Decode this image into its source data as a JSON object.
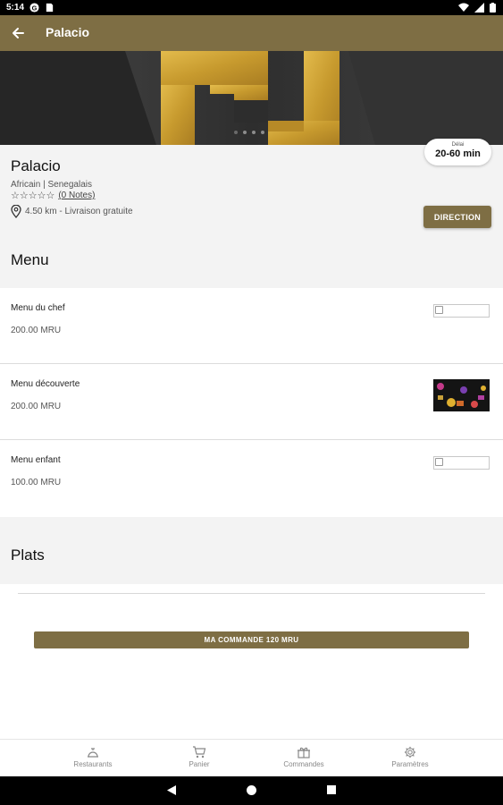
{
  "status_bar": {
    "time": "5:14",
    "icons_left": [
      "g-icon",
      "sim-icon"
    ],
    "icons_right": [
      "wifi-icon",
      "signal-icon",
      "battery-icon"
    ]
  },
  "app_bar": {
    "title": "Palacio",
    "back_icon": "arrow-left-icon"
  },
  "hero": {
    "carousel_dots": 4
  },
  "restaurant": {
    "name": "Palacio",
    "cuisine": "Africain | Senegalais",
    "stars": "☆☆☆☆☆",
    "notes": "(0 Notes)",
    "distance": "4.50 km - Livraison gratuite",
    "direction_label": "DIRECTION",
    "delay_label": "Délai",
    "delay_value": "20-60 min"
  },
  "menu_section": {
    "title": "Menu",
    "items": [
      {
        "name": "Menu du chef",
        "price": "200.00 MRU"
      },
      {
        "name": "Menu découverte",
        "price": "200.00 MRU"
      },
      {
        "name": "Menu enfant",
        "price": "100.00 MRU"
      }
    ]
  },
  "plats_section": {
    "title": "Plats"
  },
  "order_button": {
    "label": "MA COMMANDE 120 MRU"
  },
  "bottom_nav": [
    {
      "label": "Restaurants",
      "icon": "restaurant-icon"
    },
    {
      "label": "Panier",
      "icon": "cart-icon"
    },
    {
      "label": "Commandes",
      "icon": "gift-icon"
    },
    {
      "label": "Paramètres",
      "icon": "gear-icon"
    }
  ],
  "colors": {
    "accent": "#7e6e44",
    "gold": "#c9a23a",
    "section_bg": "#f3f3f3"
  }
}
